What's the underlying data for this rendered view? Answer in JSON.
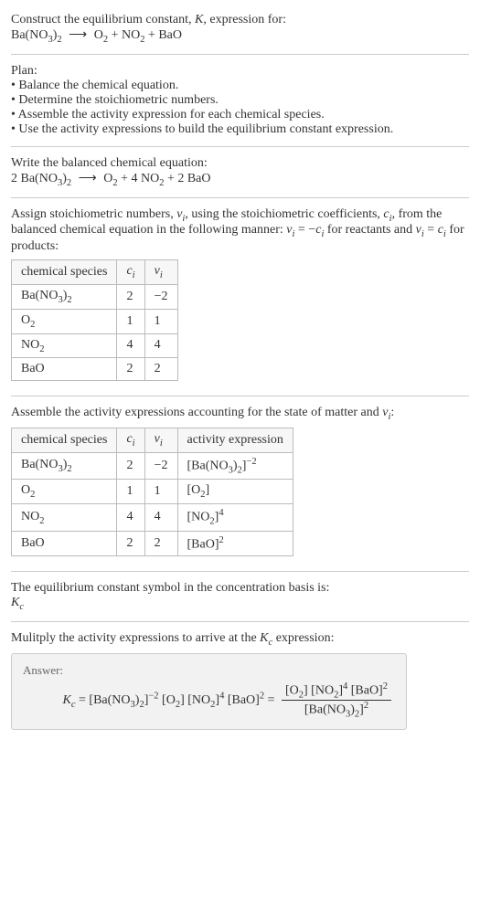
{
  "intro": {
    "line1_pre": "Construct the equilibrium constant, ",
    "line1_K": "K",
    "line1_post": ", expression for:",
    "reaction_lhs": "Ba(NO",
    "reaction_lhs_sub1": "3",
    "reaction_lhs_post1": ")",
    "reaction_lhs_sub2": "2",
    "arrow": "⟶",
    "rhs_o2": "O",
    "rhs_o2_sub": "2",
    "rhs_plus1": " + NO",
    "rhs_no2_sub": "2",
    "rhs_plus2": " + BaO"
  },
  "plan": {
    "title": "Plan:",
    "b1": "• Balance the chemical equation.",
    "b2": "• Determine the stoichiometric numbers.",
    "b3": "• Assemble the activity expression for each chemical species.",
    "b4": "• Use the activity expressions to build the equilibrium constant expression."
  },
  "balanced": {
    "title": "Write the balanced chemical equation:",
    "lhs_coeff": "2 Ba(NO",
    "lhs_sub1": "3",
    "lhs_mid": ")",
    "lhs_sub2": "2",
    "arrow": "⟶",
    "rhs": "O",
    "rhs_o2_sub": "2",
    "rhs_mid1": " + 4 NO",
    "rhs_no2_sub": "2",
    "rhs_mid2": " + 2 BaO"
  },
  "assign": {
    "text_pre": "Assign stoichiometric numbers, ",
    "nu": "ν",
    "nu_sub": "i",
    "text_mid1": ", using the stoichiometric coefficients, ",
    "c": "c",
    "c_sub": "i",
    "text_mid2": ", from the balanced chemical equation in the following manner: ",
    "eq1_lhs": "ν",
    "eq1_lhs_sub": "i",
    "eq1_eq": " = −",
    "eq1_rhs": "c",
    "eq1_rhs_sub": "i",
    "text_mid3": " for reactants and ",
    "eq2_lhs": "ν",
    "eq2_lhs_sub": "i",
    "eq2_eq": " = ",
    "eq2_rhs": "c",
    "eq2_rhs_sub": "i",
    "text_mid4": " for products:"
  },
  "table1": {
    "h1": "chemical species",
    "h2": "c",
    "h2_sub": "i",
    "h3": "ν",
    "h3_sub": "i",
    "rows": [
      {
        "sp_pre": "Ba(NO",
        "sp_sub1": "3",
        "sp_mid": ")",
        "sp_sub2": "2",
        "c": "2",
        "v": "−2"
      },
      {
        "sp_pre": "O",
        "sp_sub1": "2",
        "sp_mid": "",
        "sp_sub2": "",
        "c": "1",
        "v": "1"
      },
      {
        "sp_pre": "NO",
        "sp_sub1": "2",
        "sp_mid": "",
        "sp_sub2": "",
        "c": "4",
        "v": "4"
      },
      {
        "sp_pre": "BaO",
        "sp_sub1": "",
        "sp_mid": "",
        "sp_sub2": "",
        "c": "2",
        "v": "2"
      }
    ]
  },
  "assemble": {
    "text_pre": "Assemble the activity expressions accounting for the state of matter and ",
    "nu": "ν",
    "nu_sub": "i",
    "text_post": ":"
  },
  "table2": {
    "h1": "chemical species",
    "h2": "c",
    "h2_sub": "i",
    "h3": "ν",
    "h3_sub": "i",
    "h4": "activity expression",
    "rows": [
      {
        "sp_pre": "Ba(NO",
        "sp_sub1": "3",
        "sp_mid": ")",
        "sp_sub2": "2",
        "c": "2",
        "v": "−2",
        "act_pre": "[Ba(NO",
        "act_sub1": "3",
        "act_mid": ")",
        "act_sub2": "2",
        "act_post": "]",
        "act_exp": "−2"
      },
      {
        "sp_pre": "O",
        "sp_sub1": "2",
        "sp_mid": "",
        "sp_sub2": "",
        "c": "1",
        "v": "1",
        "act_pre": "[O",
        "act_sub1": "2",
        "act_mid": "",
        "act_sub2": "",
        "act_post": "]",
        "act_exp": ""
      },
      {
        "sp_pre": "NO",
        "sp_sub1": "2",
        "sp_mid": "",
        "sp_sub2": "",
        "c": "4",
        "v": "4",
        "act_pre": "[NO",
        "act_sub1": "2",
        "act_mid": "",
        "act_sub2": "",
        "act_post": "]",
        "act_exp": "4"
      },
      {
        "sp_pre": "BaO",
        "sp_sub1": "",
        "sp_mid": "",
        "sp_sub2": "",
        "c": "2",
        "v": "2",
        "act_pre": "[BaO",
        "act_sub1": "",
        "act_mid": "",
        "act_sub2": "",
        "act_post": "]",
        "act_exp": "2"
      }
    ]
  },
  "symbol": {
    "line": "The equilibrium constant symbol in the concentration basis is:",
    "K": "K",
    "K_sub": "c"
  },
  "mult": {
    "text": "Mulitply the activity expressions to arrive at the ",
    "K": "K",
    "K_sub": "c",
    "text2": " expression:"
  },
  "answer": {
    "label": "Answer:",
    "Kc_K": "K",
    "Kc_sub": "c",
    "eq": " = ",
    "t1_pre": "[Ba(NO",
    "t1_s1": "3",
    "t1_mid": ")",
    "t1_s2": "2",
    "t1_post": "]",
    "t1_exp": "−2",
    "t2_pre": " [O",
    "t2_s1": "2",
    "t2_post": "]",
    "t3_pre": " [NO",
    "t3_s1": "2",
    "t3_post": "]",
    "t3_exp": "4",
    "t4_pre": " [BaO]",
    "t4_exp": "2",
    "eq2": " = ",
    "num_t1_pre": "[O",
    "num_t1_s": "2",
    "num_t1_post": "] ",
    "num_t2_pre": "[NO",
    "num_t2_s": "2",
    "num_t2_post": "]",
    "num_t2_exp": "4",
    "num_t3_pre": " [BaO]",
    "num_t3_exp": "2",
    "den_pre": "[Ba(NO",
    "den_s1": "3",
    "den_mid": ")",
    "den_s2": "2",
    "den_post": "]",
    "den_exp": "2"
  }
}
